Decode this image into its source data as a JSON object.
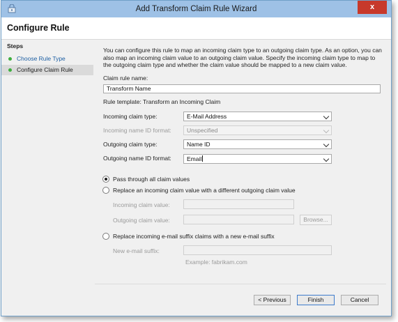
{
  "window": {
    "title": "Add Transform Claim Rule Wizard",
    "close_glyph": "x"
  },
  "page": {
    "title": "Configure Rule"
  },
  "steps": {
    "title": "Steps",
    "items": [
      {
        "label": "Choose Rule Type"
      },
      {
        "label": "Configure Claim Rule"
      }
    ]
  },
  "main": {
    "description": "You can configure this rule to map an incoming claim type to an outgoing claim type. As an option, you can also map an incoming claim value to an outgoing claim value. Specify the incoming claim type to map to the outgoing claim type and whether the claim value should be mapped to a new claim value.",
    "rule_name_label": "Claim rule name:",
    "rule_name_value": "Transform Name",
    "rule_template": "Rule template: Transform an Incoming Claim",
    "incoming_claim_type_label": "Incoming claim type:",
    "incoming_claim_type_value": "E-Mail Address",
    "incoming_name_id_label": "Incoming name ID format:",
    "incoming_name_id_value": "Unspecified",
    "outgoing_claim_type_label": "Outgoing claim type:",
    "outgoing_claim_type_value": "Name ID",
    "outgoing_name_id_label": "Outgoing name ID format:",
    "outgoing_name_id_value": "Email",
    "options": {
      "pass_through": "Pass through all claim values",
      "replace_value": "Replace an incoming claim value with a different outgoing claim value",
      "incoming_value_label": "Incoming claim value:",
      "outgoing_value_label": "Outgoing claim value:",
      "browse": "Browse...",
      "replace_suffix": "Replace incoming e-mail suffix claims with a new e-mail suffix",
      "new_suffix_label": "New e-mail suffix:",
      "example": "Example: fabrikam.com"
    }
  },
  "buttons": {
    "previous": "< Previous",
    "finish": "Finish",
    "cancel": "Cancel"
  },
  "colors": {
    "titlebar": "#9ec1e6",
    "close": "#c7392b",
    "step_link": "#1d5fa3",
    "step_dot": "#3fae3f"
  }
}
